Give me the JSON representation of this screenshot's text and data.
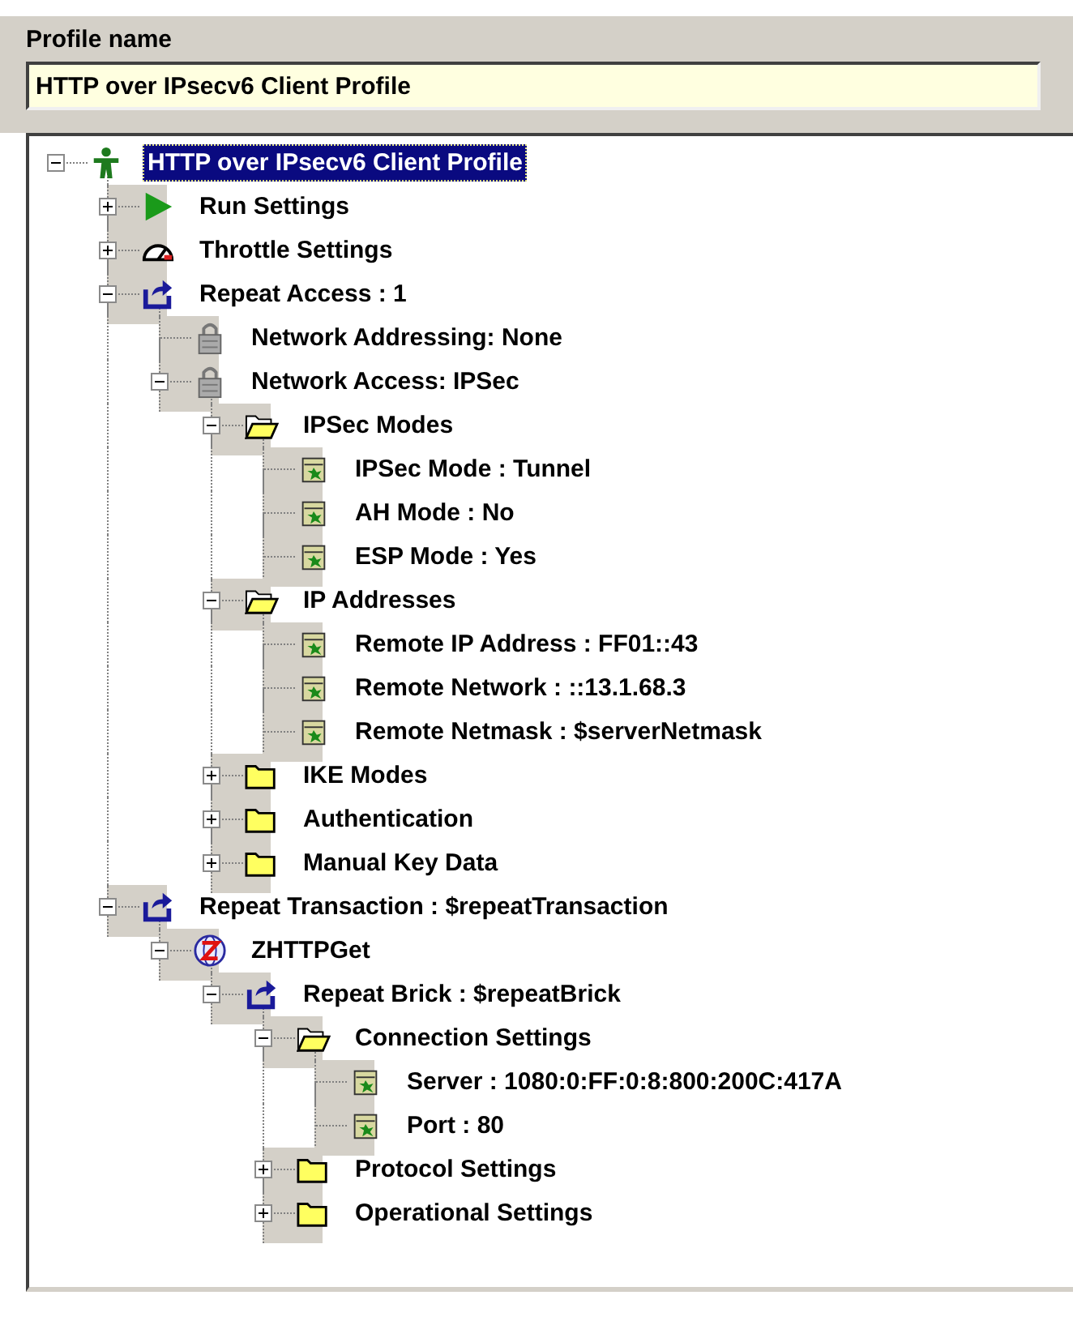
{
  "profile_name": {
    "label": "Profile name",
    "value": "HTTP over IPsecv6 Client Profile"
  },
  "tree": [
    {
      "label": "HTTP over IPsecv6 Client Profile",
      "kind": "person",
      "expanded": true,
      "selected": true,
      "children": [
        {
          "label": "Run Settings",
          "kind": "play",
          "expanded": false,
          "selected": false
        },
        {
          "label": "Throttle Settings",
          "kind": "gauge",
          "expanded": false,
          "selected": false
        },
        {
          "label": "Repeat Access : 1",
          "kind": "repeat",
          "expanded": true,
          "selected": false,
          "children": [
            {
              "label": "Network Addressing: None",
              "kind": "lock",
              "selected": false
            },
            {
              "label": "Network Access: IPSec",
              "kind": "lock",
              "expanded": true,
              "selected": false,
              "children": [
                {
                  "label": "IPSec Modes",
                  "kind": "folder",
                  "expanded": true,
                  "selected": false,
                  "children": [
                    {
                      "label": "IPSec Mode : Tunnel",
                      "kind": "setting",
                      "selected": false
                    },
                    {
                      "label": "AH Mode : No",
                      "kind": "setting",
                      "selected": false
                    },
                    {
                      "label": "ESP Mode : Yes",
                      "kind": "setting",
                      "selected": false
                    }
                  ]
                },
                {
                  "label": "IP Addresses",
                  "kind": "folder",
                  "expanded": true,
                  "selected": false,
                  "children": [
                    {
                      "label": "Remote IP Address : FF01::43",
                      "kind": "setting",
                      "selected": false
                    },
                    {
                      "label": "Remote Network : ::13.1.68.3",
                      "kind": "setting",
                      "selected": false
                    },
                    {
                      "label": "Remote Netmask : $serverNetmask",
                      "kind": "setting",
                      "selected": false
                    }
                  ]
                },
                {
                  "label": "IKE Modes",
                  "kind": "folder",
                  "expanded": false,
                  "selected": false
                },
                {
                  "label": "Authentication",
                  "kind": "folder",
                  "expanded": false,
                  "selected": false
                },
                {
                  "label": "Manual Key Data",
                  "kind": "folder",
                  "expanded": false,
                  "selected": false
                }
              ]
            }
          ]
        },
        {
          "label": "Repeat Transaction : $repeatTransaction",
          "kind": "repeat",
          "expanded": true,
          "selected": false,
          "children": [
            {
              "label": "ZHTTPGet",
              "kind": "globe",
              "expanded": true,
              "selected": false,
              "children": [
                {
                  "label": "Repeat Brick : $repeatBrick",
                  "kind": "repeat",
                  "expanded": true,
                  "selected": false,
                  "children": [
                    {
                      "label": "Connection Settings",
                      "kind": "folder",
                      "expanded": true,
                      "selected": false,
                      "children": [
                        {
                          "label": "Server : 1080:0:FF:0:8:800:200C:417A",
                          "kind": "setting",
                          "selected": false
                        },
                        {
                          "label": "Port : 80",
                          "kind": "setting",
                          "selected": false
                        }
                      ]
                    },
                    {
                      "label": "Protocol Settings",
                      "kind": "folder",
                      "expanded": false,
                      "selected": false
                    },
                    {
                      "label": "Operational Settings",
                      "kind": "folder",
                      "expanded": false,
                      "selected": false
                    }
                  ]
                }
              ]
            }
          ]
        }
      ]
    }
  ]
}
